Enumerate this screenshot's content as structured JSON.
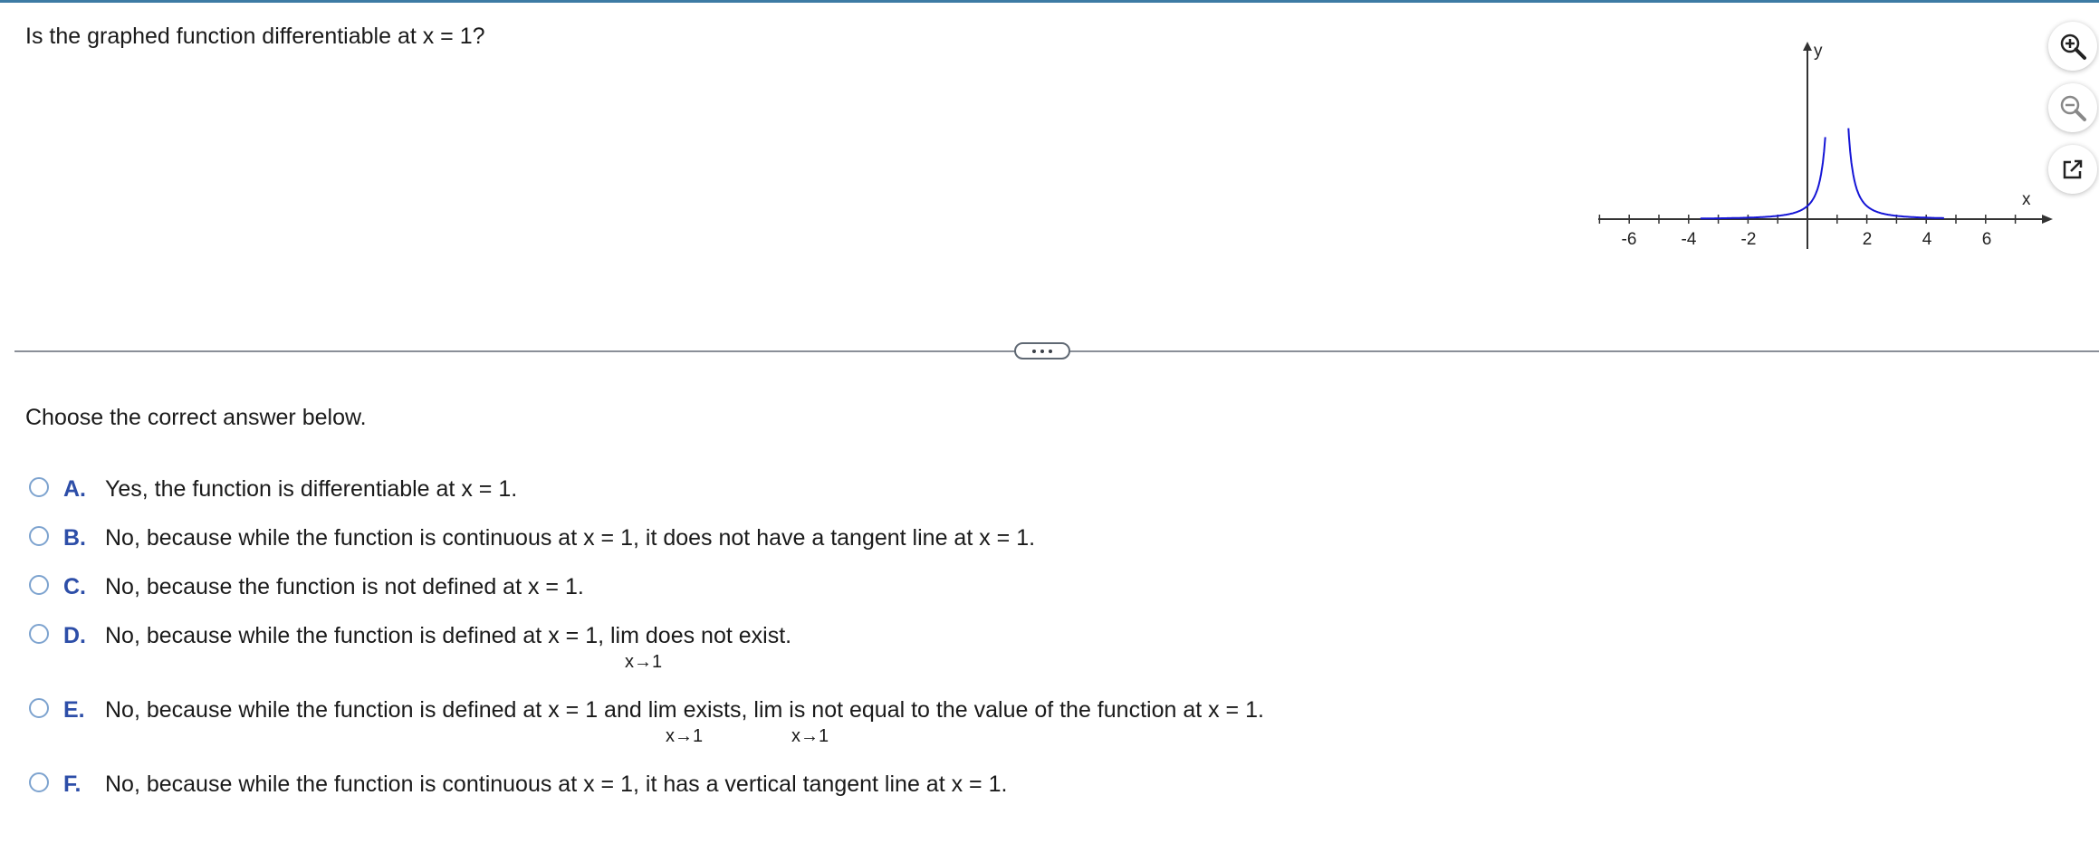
{
  "question": "Is the graphed function differentiable at x = 1?",
  "graph": {
    "y_axis_label": "y",
    "x_axis_label": "x",
    "x_ticks": [
      "-6",
      "-4",
      "-2",
      "2",
      "4",
      "6"
    ],
    "curve_color": "#1515d6"
  },
  "tools": {
    "zoom_in_icon": "zoom-in-icon",
    "zoom_out_icon": "zoom-out-icon",
    "popout_icon": "open-in-new-window-icon"
  },
  "instruction": "Choose the correct answer below.",
  "options": [
    {
      "letter": "A.",
      "text": "Yes, the function is differentiable at x = 1."
    },
    {
      "letter": "B.",
      "text": "No, because while the function is continuous at x = 1, it does not have a tangent line at x = 1."
    },
    {
      "letter": "C.",
      "text": "No, because the function is not defined at x = 1."
    },
    {
      "letter": "D.",
      "parts": [
        "No, because while the function is defined at x = 1,",
        "lim",
        "does not exist."
      ],
      "lim_sub": "x→1"
    },
    {
      "letter": "E.",
      "parts": [
        "No, because while the function is defined at x = 1 and",
        "lim",
        "exists,",
        "lim",
        "is not equal to the value of the function at x = 1."
      ],
      "lim_sub": "x→1"
    },
    {
      "letter": "F.",
      "text": "No, because while the function is continuous at x = 1, it has a vertical tangent line at x = 1."
    }
  ],
  "colors": {
    "accent_border": "#3d7ba4",
    "option_letter": "#2d4ea8",
    "radio_border": "#7da3cf"
  }
}
